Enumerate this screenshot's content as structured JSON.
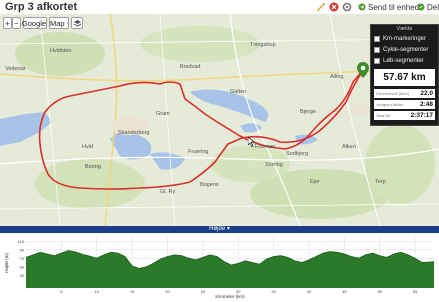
{
  "header": {
    "title": "Grp 3 afkortet",
    "send_label": "Send til enhed",
    "share_label": "Del"
  },
  "map": {
    "type_label": "Google",
    "map_label": "Map",
    "towns": [
      "Hvidsten",
      "Vedersø",
      "Tvingstrup",
      "Skanderborg",
      "Gram",
      "Bjerge",
      "Sorring",
      "Boring",
      "Foxmær",
      "Hvid",
      "Bogens",
      "Sodbjerg",
      "Alken",
      "Fruering",
      "Bredvad",
      "Alling",
      "Gl. Ry",
      "Terp",
      "Galten",
      "Ejer"
    ],
    "route_color": "#d8302c"
  },
  "panel": {
    "title": "Vælde",
    "km_markers": "Km-markeringer",
    "bike_segments": "Cykle-segmenter",
    "run_segments": "Løb-segmenter",
    "distance": "57.67 km",
    "stats": [
      {
        "label": "Gennemsnit (km/t)",
        "value": "22.0"
      },
      {
        "label": "Varighed tid/km",
        "value": "2:48"
      },
      {
        "label": "Total tid",
        "value": "2:37:17"
      }
    ]
  },
  "elevation": {
    "title": "Højde ▾",
    "ylabel": "Højde (m)",
    "xlabel": "Kilometer (km)"
  },
  "chart_data": {
    "type": "area",
    "title": "Højde",
    "xlabel": "Kilometer (km)",
    "ylabel": "Højde (m)",
    "xlim": [
      0,
      57.67
    ],
    "ylim": [
      0,
      120
    ],
    "yticks": [
      "110",
      "90",
      "70",
      "50",
      "30"
    ],
    "xticks": [
      "5",
      "10",
      "15",
      "20",
      "25",
      "30",
      "35",
      "40",
      "45",
      "50",
      "55"
    ],
    "x": [
      0,
      1,
      2,
      3,
      4,
      5,
      6,
      7,
      8,
      9,
      10,
      11,
      12,
      13,
      14,
      15,
      16,
      17,
      18,
      19,
      20,
      21,
      22,
      23,
      24,
      25,
      26,
      27,
      28,
      29,
      30,
      31,
      32,
      33,
      34,
      35,
      36,
      37,
      38,
      39,
      40,
      41,
      42,
      43,
      44,
      45,
      46,
      47,
      48,
      49,
      50,
      51,
      52,
      53,
      54,
      55,
      56,
      57.67
    ],
    "y": [
      72,
      78,
      84,
      80,
      76,
      82,
      88,
      85,
      79,
      75,
      70,
      78,
      84,
      82,
      74,
      52,
      46,
      50,
      58,
      68,
      74,
      78,
      76,
      70,
      66,
      72,
      78,
      74,
      62,
      54,
      58,
      64,
      60,
      56,
      68,
      74,
      76,
      72,
      64,
      60,
      66,
      74,
      82,
      86,
      84,
      80,
      74,
      70,
      78,
      82,
      76,
      72,
      80,
      84,
      78,
      70,
      60,
      62
    ],
    "grid": true,
    "fill_color": "#2a7a2a",
    "line_color": "#1c5d1c"
  }
}
